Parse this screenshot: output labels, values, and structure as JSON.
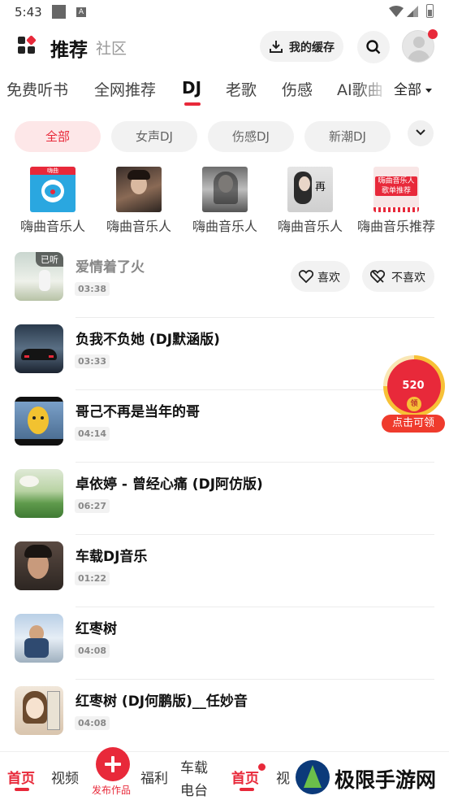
{
  "status_bar": {
    "time": "5:43",
    "a_badge": "A"
  },
  "header": {
    "title": "推荐",
    "subtitle": "社区",
    "cache_label": "我的缓存"
  },
  "tabs": [
    {
      "label": "免费听书"
    },
    {
      "label": "全网推荐"
    },
    {
      "label": "DJ"
    },
    {
      "label": "老歌"
    },
    {
      "label": "伤感"
    },
    {
      "label": "AI歌曲"
    }
  ],
  "tab_all": "全部",
  "chips": [
    {
      "label": "全部"
    },
    {
      "label": "女声DJ"
    },
    {
      "label": "伤感DJ"
    },
    {
      "label": "新潮DJ"
    }
  ],
  "artists": [
    {
      "name": "嗨曲音乐人",
      "cover_text": "嗨曲"
    },
    {
      "name": "嗨曲音乐人"
    },
    {
      "name": "嗨曲音乐人"
    },
    {
      "name": "嗨曲音乐人",
      "cover_text": "再"
    },
    {
      "name": "嗨曲音乐推荐",
      "cover_text": "嗨曲音乐人 歌单推荐"
    }
  ],
  "songs": [
    {
      "title": "爱情着了火",
      "duration": "03:38",
      "badge": "已听"
    },
    {
      "title": "负我不负她 (DJ默涵版)",
      "duration": "03:33"
    },
    {
      "title": "哥己不再是当年的哥",
      "duration": "04:14"
    },
    {
      "title": "卓依婷 - 曾经心痛 (DJ阿仿版)",
      "duration": "06:27"
    },
    {
      "title": "车载DJ音乐",
      "duration": "01:22"
    },
    {
      "title": "红枣树",
      "duration": "04:08"
    },
    {
      "title": "红枣树 (DJ何鹏版)__任妙音",
      "duration": "04:08"
    }
  ],
  "song_actions": {
    "like": "喜欢",
    "dislike": "不喜欢"
  },
  "reward": {
    "amount": "520",
    "coin": "领",
    "label": "点击可领"
  },
  "bottom_nav": {
    "home": "首页",
    "video": "视频",
    "publish": "发布作品",
    "welfare": "福利",
    "car_radio_line1": "车载",
    "car_radio_line2": "电台",
    "home2": "首页",
    "video2": "视"
  },
  "watermark": "极限手游网"
}
